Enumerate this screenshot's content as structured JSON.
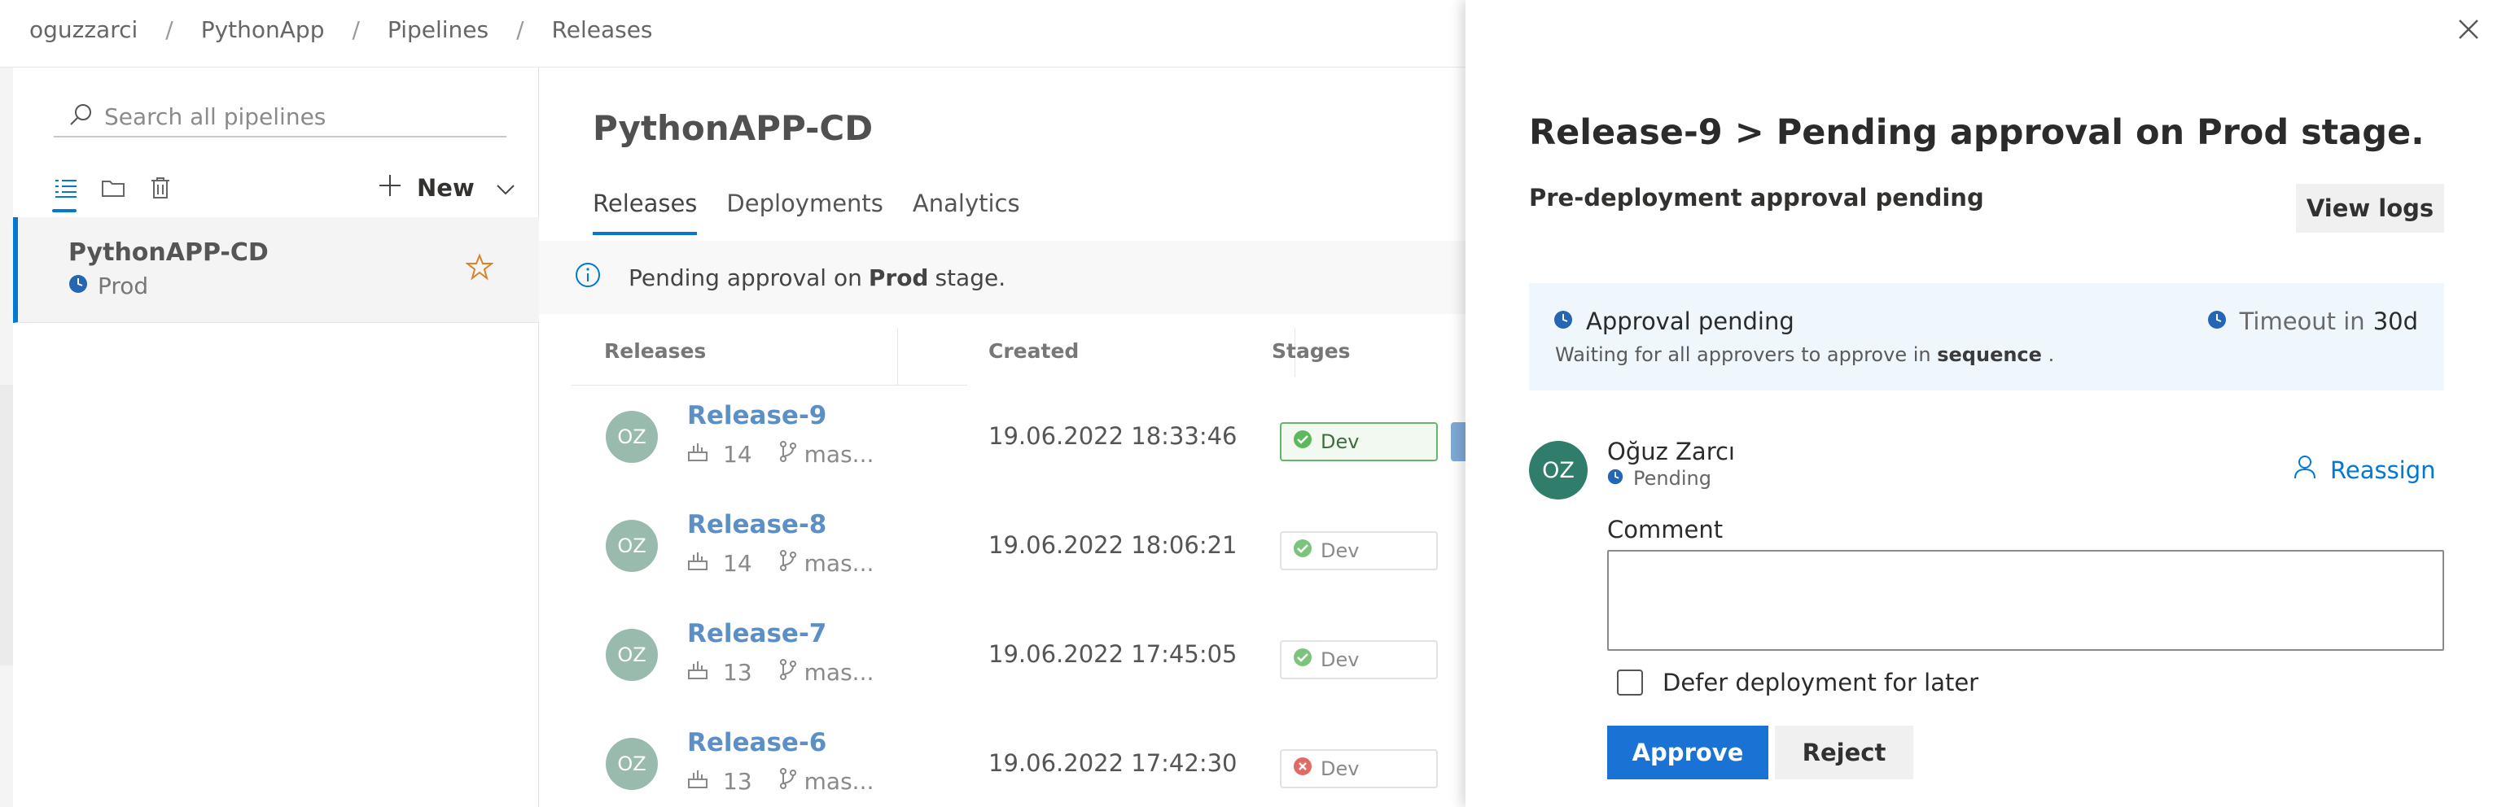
{
  "breadcrumb": {
    "items": [
      "oguzzarci",
      "PythonApp",
      "Pipelines",
      "Releases"
    ],
    "separator": "/"
  },
  "sidebar": {
    "search_placeholder": "Search all pipelines",
    "toolbar": {
      "icons": [
        "list-view-icon",
        "folder-view-icon",
        "trash-icon"
      ],
      "new_label": "New"
    },
    "pipeline": {
      "name": "PythonAPP-CD",
      "stage": "Prod"
    }
  },
  "main": {
    "title": "PythonAPP-CD",
    "tabs": [
      {
        "label": "Releases",
        "active": true
      },
      {
        "label": "Deployments",
        "active": false
      },
      {
        "label": "Analytics",
        "active": false
      }
    ],
    "banner": {
      "prefix": "Pending approval on",
      "stage": "Prod",
      "suffix": "stage."
    },
    "table": {
      "headers": [
        "Releases",
        "Created",
        "Stages"
      ],
      "rows": [
        {
          "initials": "OZ",
          "name": "Release-9",
          "build": "14",
          "branch": "mas...",
          "created": "19.06.2022 18:33:46",
          "stage": "Dev",
          "stage_status": "succeeded",
          "selected": true
        },
        {
          "initials": "OZ",
          "name": "Release-8",
          "build": "14",
          "branch": "mas...",
          "created": "19.06.2022 18:06:21",
          "stage": "Dev",
          "stage_status": "succeeded",
          "selected": false
        },
        {
          "initials": "OZ",
          "name": "Release-7",
          "build": "13",
          "branch": "mas...",
          "created": "19.06.2022 17:45:05",
          "stage": "Dev",
          "stage_status": "succeeded",
          "selected": false
        },
        {
          "initials": "OZ",
          "name": "Release-6",
          "build": "13",
          "branch": "mas...",
          "created": "19.06.2022 17:42:30",
          "stage": "Dev",
          "stage_status": "failed",
          "selected": false
        }
      ]
    }
  },
  "panel": {
    "title": "Release-9 > Pending approval on Prod stage.",
    "subtitle": "Pre-deployment approval pending",
    "view_logs_label": "View logs",
    "approval": {
      "status": "Approval pending",
      "description_prefix": "Waiting for all approvers to approve in",
      "description_mode": "sequence",
      "description_suffix": ".",
      "timeout_label": "Timeout in",
      "timeout_value": "30d"
    },
    "approver": {
      "initials": "OZ",
      "name": "Oğuz Zarcı",
      "status": "Pending",
      "reassign_label": "Reassign"
    },
    "comment_label": "Comment",
    "comment_value": "",
    "defer_label": "Defer deployment for later",
    "defer_checked": false,
    "approve_label": "Approve",
    "reject_label": "Reject"
  },
  "colors": {
    "accent": "#0078d4",
    "success": "#5cb85c",
    "failure": "#d9534f",
    "pending": "#2566b4",
    "avatar_main": "#2f7d6a",
    "avatar_list": "#8fb4a6"
  }
}
